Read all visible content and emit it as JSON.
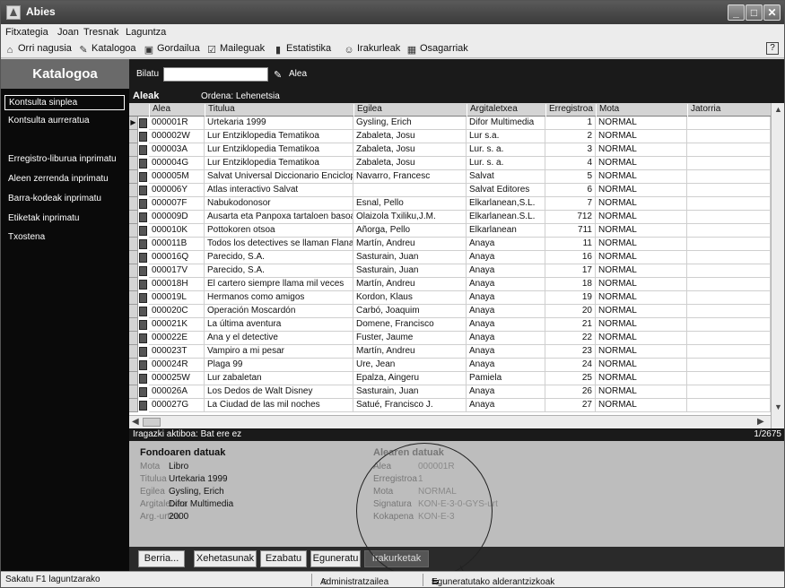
{
  "window": {
    "title": "Abies"
  },
  "menu": [
    "Fitxategia",
    "Joan",
    "Tresnak",
    "Laguntza"
  ],
  "toolbar": [
    {
      "label": "Orri nagusia",
      "icon": "home-icon"
    },
    {
      "label": "Katalogoa",
      "icon": "catalog-icon"
    },
    {
      "label": "Gordailua",
      "icon": "storage-icon"
    },
    {
      "label": "Maileguak",
      "icon": "loan-icon"
    },
    {
      "label": "Estatistika",
      "icon": "chart-icon"
    },
    {
      "label": "Irakurleak",
      "icon": "readers-icon"
    },
    {
      "label": "Osagarriak",
      "icon": "extras-icon"
    }
  ],
  "sidebar": {
    "title": "Katalogoa",
    "items": [
      "Kontsulta sinplea",
      "Kontsulta aurreratua",
      "Erregistro-liburua inprimatu",
      "Aleen zerrenda inprimatu",
      "Barra-kodeak inprimatu",
      "Etiketak inprimatu",
      "Txostena"
    ]
  },
  "search": {
    "label": "Bilatu",
    "value": "",
    "field": "Alea"
  },
  "grid": {
    "title": "Aleak",
    "order": "Ordena: Lehenetsia",
    "columns": [
      "Alea",
      "Titulua",
      "Egilea",
      "Argitaletxea",
      "Erregistroa",
      "Mota",
      "Jatorria"
    ],
    "rows": [
      [
        "000001R",
        "Urtekaria 1999",
        "Gysling, Erich",
        "Difor Multimedia",
        "1",
        "NORMAL",
        ""
      ],
      [
        "000002W",
        "Lur Entziklopedia Tematikoa",
        "Zabaleta, Josu",
        "Lur s.a.",
        "2",
        "NORMAL",
        ""
      ],
      [
        "000003A",
        "Lur Entziklopedia Tematikoa",
        "Zabaleta, Josu",
        "Lur. s. a.",
        "3",
        "NORMAL",
        ""
      ],
      [
        "000004G",
        "Lur Entziklopedia Tematikoa",
        "Zabaleta, Josu",
        "Lur. s. a.",
        "4",
        "NORMAL",
        ""
      ],
      [
        "000005M",
        "Salvat Universal Diccionario Enciclopédi",
        "Navarro, Francesc",
        "Salvat",
        "5",
        "NORMAL",
        ""
      ],
      [
        "000006Y",
        "Atlas interactivo Salvat",
        "",
        "Salvat Editores",
        "6",
        "NORMAL",
        ""
      ],
      [
        "000007F",
        "Nabukodonosor",
        "Esnal, Pello",
        "Elkarlanean,S.L.",
        "7",
        "NORMAL",
        ""
      ],
      [
        "000009D",
        "Ausarta eta Panpoxa tartaloen basoan",
        "Olaizola Txiliku,J.M.",
        "Elkarlanean.S.L.",
        "712",
        "NORMAL",
        ""
      ],
      [
        "000010K",
        "Pottokoren otsoa",
        "Añorga, Pello",
        "Elkarlanean",
        "711",
        "NORMAL",
        ""
      ],
      [
        "000011B",
        "Todos los detectives se llaman Flanagan",
        "Martín, Andreu",
        "Anaya",
        "11",
        "NORMAL",
        ""
      ],
      [
        "000016Q",
        "Parecido, S.A.",
        "Sasturain, Juan",
        "Anaya",
        "16",
        "NORMAL",
        ""
      ],
      [
        "000017V",
        "Parecido, S.A.",
        "Sasturain, Juan",
        "Anaya",
        "17",
        "NORMAL",
        ""
      ],
      [
        "000018H",
        "El cartero siempre llama mil veces",
        "Martín, Andreu",
        "Anaya",
        "18",
        "NORMAL",
        ""
      ],
      [
        "000019L",
        "Hermanos como amigos",
        "Kordon, Klaus",
        "Anaya",
        "19",
        "NORMAL",
        ""
      ],
      [
        "000020C",
        "Operación Moscardón",
        "Carbó, Joaquim",
        "Anaya",
        "20",
        "NORMAL",
        ""
      ],
      [
        "000021K",
        "La última aventura",
        "Domene, Francisco",
        "Anaya",
        "21",
        "NORMAL",
        ""
      ],
      [
        "000022E",
        "Ana y el detective",
        "Fuster, Jaume",
        "Anaya",
        "22",
        "NORMAL",
        ""
      ],
      [
        "000023T",
        "Vampiro a mi pesar",
        "Martín, Andreu",
        "Anaya",
        "23",
        "NORMAL",
        ""
      ],
      [
        "000024R",
        "Plaga 99",
        "Ure, Jean",
        "Anaya",
        "24",
        "NORMAL",
        ""
      ],
      [
        "000025W",
        "Lur zabaletan",
        "Epalza, Aingeru",
        "Pamiela",
        "25",
        "NORMAL",
        ""
      ],
      [
        "000026A",
        "Los Dedos de Walt Disney",
        "Sasturain, Juan",
        "Anaya",
        "26",
        "NORMAL",
        ""
      ],
      [
        "000027G",
        "La Ciudad de las mil noches",
        "Satué, Francisco J.",
        "Anaya",
        "27",
        "NORMAL",
        ""
      ]
    ]
  },
  "status": {
    "filter": "Iragazki aktiboa: Bat ere ez",
    "position": "1/2675"
  },
  "fondo": {
    "title": "Fondoaren datuak",
    "fields": [
      {
        "label": "Mota",
        "value": "Libro"
      },
      {
        "label": "Titulua",
        "value": "Urtekaria 1999"
      },
      {
        "label": "Egilea",
        "value": "Gysling, Erich"
      },
      {
        "label": "Argitaletxea",
        "value": "Difor Multimedia"
      },
      {
        "label": "Arg.-urtea",
        "value": "2000"
      }
    ]
  },
  "alea": {
    "title": "Alearen datuak",
    "fields": [
      {
        "label": "Alea",
        "value": "000001R"
      },
      {
        "label": "Erregistroa",
        "value": "1"
      },
      {
        "label": "Mota",
        "value": "NORMAL"
      },
      {
        "label": "Signatura",
        "value": "KON-E-3-0-GYS-urt"
      },
      {
        "label": "Kokapena",
        "value": "KON-E-3"
      }
    ]
  },
  "actions": [
    "Berria...",
    "Xehetasunak",
    "Ezabatu",
    "Eguneratu",
    "Irakurketak"
  ],
  "footer": {
    "hint": "Sakatu F1 laguntzarako",
    "user": "Administratzailea",
    "sync": "Eguneratutako alderantzizkoak"
  },
  "colors": {
    "sidebar_bg": "#0a0a0a",
    "heading_bg": "#6a6a6a",
    "details_bg": "#bdbdbd"
  }
}
